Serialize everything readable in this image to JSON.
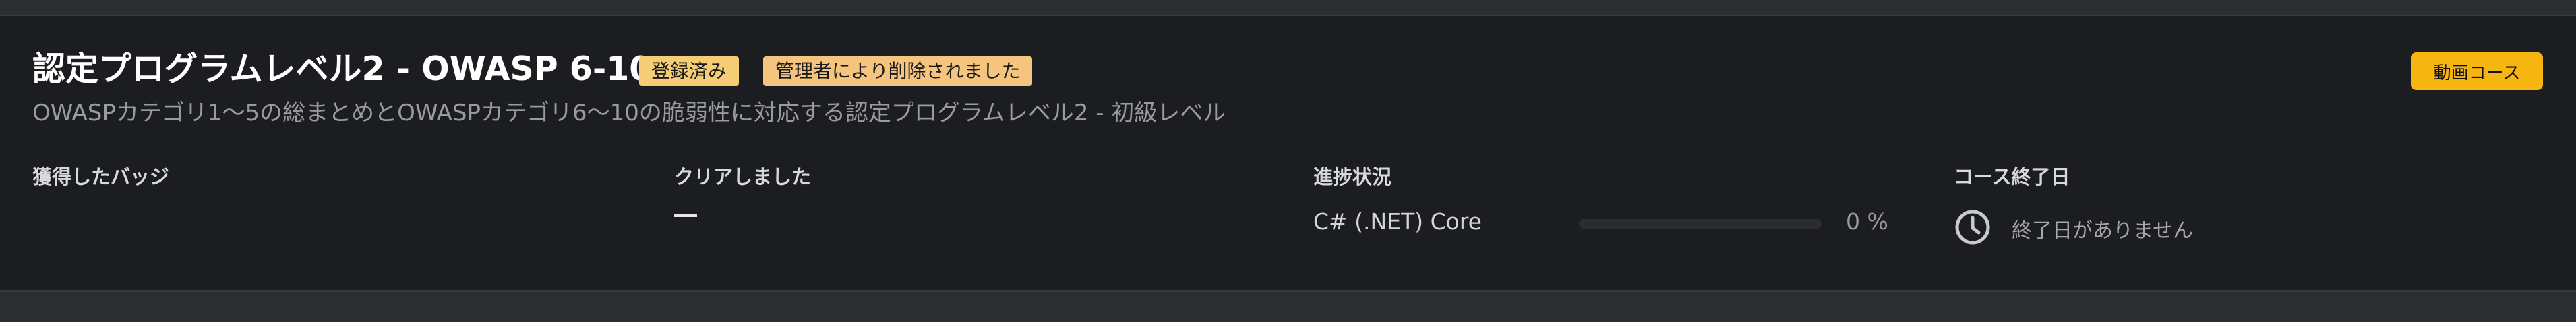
{
  "course": {
    "title": "認定プログラムレベル2 - OWASP 6-10",
    "badges": [
      "登録済み",
      "管理者により削除されました"
    ],
    "type_button": "動画コース",
    "description": "OWASPカテゴリ1〜5の総まとめとOWASPカテゴリ6〜10の脆弱性に対応する認定プログラムレベル2 - 初級レベル"
  },
  "columns": {
    "badges_label": "獲得したバッジ",
    "cleared_label": "クリアしました",
    "cleared_value": "—",
    "progress_label": "進捗状況",
    "end_date_label": "コース終了日"
  },
  "progress": {
    "course_name": "C# (.NET) Core",
    "percent_text": "0 %",
    "percent": 0
  },
  "end_date": {
    "icon": "clock-icon",
    "text": "終了日がありません"
  },
  "colors": {
    "accent": "#f7b512",
    "badge_enrolled": "#f5cd74",
    "badge_removed": "#f5c47e",
    "card_bg": "#1c1d21"
  }
}
